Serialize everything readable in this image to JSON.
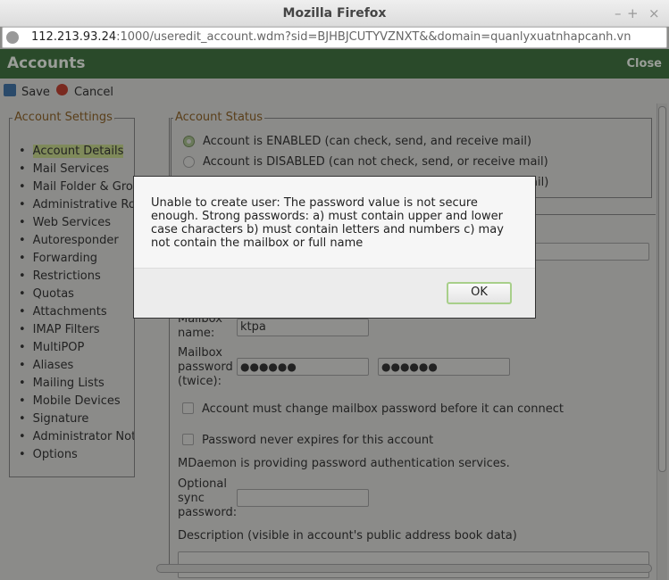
{
  "window": {
    "title": "Mozilla Firefox",
    "minimize": "–",
    "maximize": "+",
    "close": "×"
  },
  "url": {
    "host": "112.213.93.24",
    "rest": ":1000/useredit_account.wdm?sid=BJHBJCUTYVZNXT&&domain=quanlyxuatnhapcanh.vn"
  },
  "header": {
    "title": "Accounts",
    "close": "Close"
  },
  "toolbar": {
    "save": "Save",
    "cancel": "Cancel"
  },
  "settings": {
    "legend": "Account Settings",
    "items": [
      "Account Details",
      "Mail Services",
      "Mail Folder & Groups",
      "Administrative Roles",
      "Web Services",
      "Autoresponder",
      "Forwarding",
      "Restrictions",
      "Quotas",
      "Attachments",
      "IMAP Filters",
      "MultiPOP",
      "Aliases",
      "Mailing Lists",
      "Mobile Devices",
      "Signature",
      "Administrator Notes",
      "Options"
    ],
    "active": 0
  },
  "status": {
    "legend": "Account Status",
    "options": [
      "Account is ENABLED (can check, send, and receive mail)",
      "Account is DISABLED (can not check, send, or receive mail)",
      "ail)"
    ],
    "selected": 0
  },
  "form": {
    "mailbox_label": "Mailbox name:",
    "mailbox_value": "ktpa",
    "password_label": "Mailbox password (twice):",
    "password1": "●●●●●●",
    "password2": "●●●●●●",
    "must_change": "Account must change mailbox password before it can connect",
    "never_expires": "Password never expires for this account",
    "auth_note": "MDaemon is providing password authentication services.",
    "sync_label": "Optional sync password:",
    "description_label": "Description (visible in account's public address book data)"
  },
  "dialog": {
    "message": "Unable to create user: The password value is not secure enough. Strong passwords: a) must contain upper and lower case characters b) must contain letters and numbers c) may not contain the mailbox or full name",
    "ok": "OK"
  }
}
